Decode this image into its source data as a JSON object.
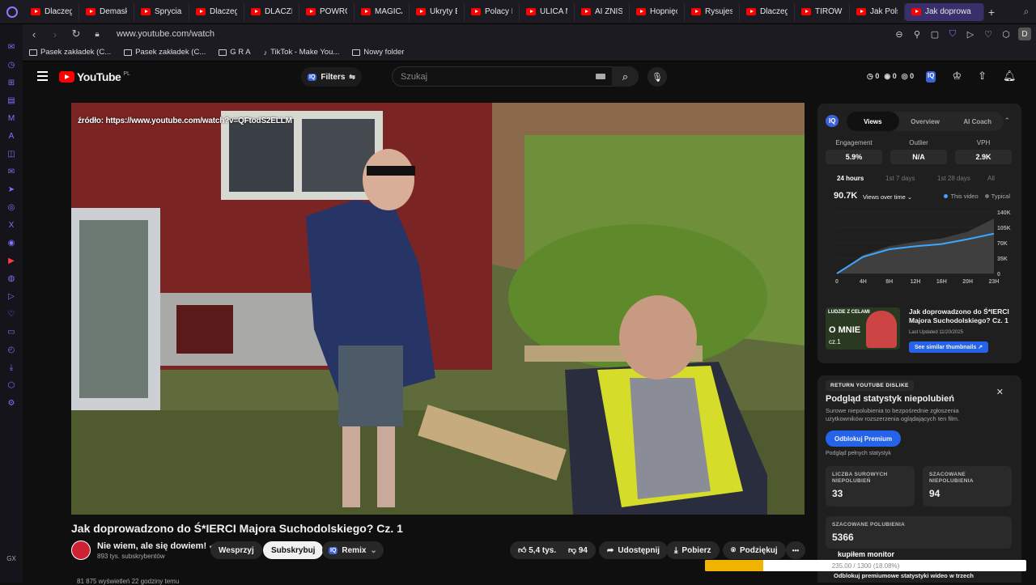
{
  "browser": {
    "tabs": [
      {
        "label": "Dlaczego"
      },
      {
        "label": "Demasku"
      },
      {
        "label": "Spryciar"
      },
      {
        "label": "Dlaczego"
      },
      {
        "label": "DLACZE"
      },
      {
        "label": "POWRÓT"
      },
      {
        "label": "MAGICA"
      },
      {
        "label": "Ukryty E"
      },
      {
        "label": "Polacy K"
      },
      {
        "label": "ULICA M"
      },
      {
        "label": "AI ZNISZ"
      },
      {
        "label": "Hopnięc"
      },
      {
        "label": "Rysujesz"
      },
      {
        "label": "Dlaczego"
      },
      {
        "label": "TIRÓWK"
      },
      {
        "label": "Jak Polsk"
      }
    ],
    "active_tab": {
      "label": "Jak doprowa"
    },
    "new_tab_glyph": "+",
    "url": "www.youtube.com/watch",
    "profile_initial": "D",
    "bookmarks": [
      {
        "label": "Pasek zakładek (C..."
      },
      {
        "label": "Pasek zakładek (C..."
      },
      {
        "label": "G R A"
      },
      {
        "label": "TikTok - Make You..."
      },
      {
        "label": "Nowy folder"
      }
    ],
    "sidebar_icons": [
      "messenger-icon",
      "history-icon",
      "bag-icon",
      "wallet-icon",
      "mail-icon",
      "aria-icon",
      "twitch-icon",
      "messenger-icon",
      "telegram-icon",
      "instagram-icon",
      "x-icon",
      "discord-icon",
      "youtube-icon",
      "spotify-icon",
      "player-icon",
      "heart-icon",
      "news-icon",
      "clock-icon",
      "download-icon",
      "extensions-icon",
      "settings-icon"
    ],
    "sidebar_footer": "GX"
  },
  "youtube": {
    "logo_text": "YouTube",
    "country_code": "PL",
    "filters_label": "Filters",
    "search_placeholder": "Szukaj",
    "header_stats": [
      "0",
      "0",
      "0"
    ],
    "accent_red": "#ff0000",
    "accent_blue": "#2563eb"
  },
  "video": {
    "source_overlay": "źródło: https://www.youtube.com/watch?v=QFtodS2ELLM",
    "title": "Jak doprowadzono do Ś*IERCI Majora Suchodolskiego? Cz. 1",
    "channel_name": "Nie wiem, ale się dowiem!",
    "subscribers": "893 tys. subskrybentów",
    "support_label": "Wesprzyj",
    "subscribe_label": "Subskrybuj",
    "remix_label": "Remix",
    "likes": "5,4 tys.",
    "dislikes": "94",
    "share_label": "Udostępnij",
    "download_label": "Pobierz",
    "thanks_label": "Podziękuj",
    "more_glyph": "•••",
    "views_line": "81 875 wyświetleń  22 godziny temu"
  },
  "vidiq": {
    "tabs": [
      "Views",
      "Overview",
      "AI Coach"
    ],
    "active_tab": "Views",
    "metrics": [
      {
        "label": "Engagement",
        "value": "5.9%"
      },
      {
        "label": "Outlier",
        "value": "N/A"
      },
      {
        "label": "VPH",
        "value": "2.9K"
      }
    ],
    "ranges": [
      "24 hours",
      "1st 7 days",
      "1st 28 days",
      "All"
    ],
    "active_range": "24 hours",
    "views_total": "90.7K",
    "views_over_time_label": "Views over time",
    "legend": {
      "this_video": "This video",
      "typical": "Typical"
    },
    "this_video_color": "#3ea6ff",
    "typical_color": "#555555"
  },
  "chart_data": {
    "type": "area",
    "x": [
      "0",
      "4H",
      "8H",
      "12H",
      "16H",
      "20H",
      "23H"
    ],
    "y_ticks": [
      "140K",
      "105K",
      "70K",
      "35K",
      "0"
    ],
    "ylim": [
      0,
      140000
    ],
    "series": [
      {
        "name": "This video",
        "values": [
          0,
          38000,
          55000,
          62000,
          67000,
          78000,
          90700
        ]
      },
      {
        "name": "Typical",
        "values": [
          0,
          42000,
          62000,
          72000,
          80000,
          95000,
          125000
        ]
      }
    ]
  },
  "related": {
    "thumb_top_text": "LUDZIE Z CELAMI",
    "thumb_big_text": "O MNIE",
    "thumb_small_text": "cz.1",
    "title": "Jak doprowadzono do Ś*IERCI Majora Suchodolskiego? Cz. 1",
    "updated": "Last Updated 11/20/2025",
    "similar_btn": "See similar thumbnails ↗"
  },
  "ryd": {
    "tag": "RETURN YOUTUBE DISLIKE",
    "title": "Podgląd statystyk niepolubień",
    "description": "Surowe niepolubienia to bezpośrednie zgłoszenia użytkowników rozszerzenia oglądających ten film.",
    "unlock_btn": "Odblokuj Premium",
    "full_stats": "Podgląd pełnych statystyk",
    "raw_label": "LICZBA SUROWYCH NIEPOLUBIEŃ",
    "raw_value": "33",
    "est_label": "SZACOWANE NIEPOLUBIENIA",
    "est_value": "94",
    "likes_label": "SZACOWANE POLUBIENIA",
    "likes_value": "5366",
    "monitor_label": "kupiłem monitor",
    "progress_text": "235.00 / 1300 (18.08%)",
    "progress_fraction": 0.1808,
    "unlock_footer": "Odblokuj premiumowe statystyki wideo w trzech"
  }
}
